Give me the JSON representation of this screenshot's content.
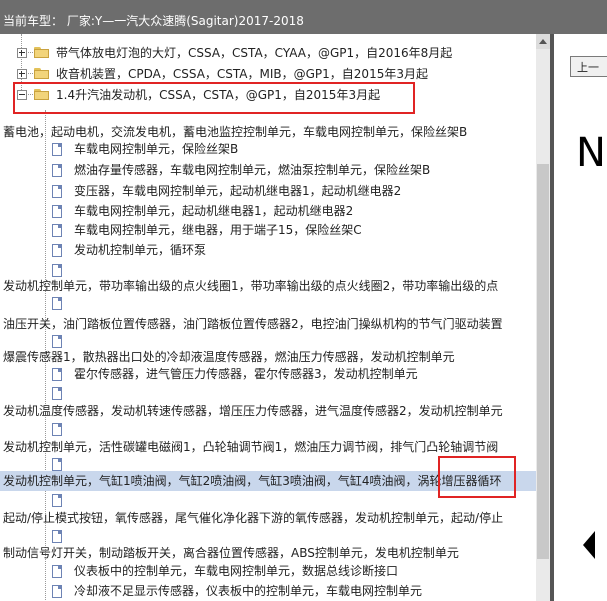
{
  "header": {
    "title": "当前车型： 厂家:Y—一汽大众速腾(Sagitar)2017-2018"
  },
  "tree": {
    "folders": [
      "带气体放电灯泡的大灯，CSSA，CSTA，CYAA，@GP1，自2016年8月起",
      "收音机装置，CPDA，CSSA，CSTA，MIB，@GP1，自2015年3月起",
      "1.4升汽油发动机，CSSA，CSTA，@GP1，自2015年3月起"
    ],
    "rows": [
      "蓄电池，起动电机，交流发电机，蓄电池监控控制单元，车载电网控制单元，保险丝架B",
      "车载电网控制单元，保险丝架B",
      "燃油存量传感器，车载电网控制单元，燃油泵控制单元，保险丝架B",
      "变压器，车载电网控制单元，起动机继电器1，起动机继电器2",
      "车载电网控制单元，起动机继电器1，起动机继电器2",
      "车载电网控制单元，继电器，用于端子15，保险丝架C",
      "发动机控制单元，循环泵",
      "",
      "发动机控制单元，带功率输出级的点火线圈1，带功率输出级的点火线圈2，带功率输出级的点",
      "",
      "油压开关，油门踏板位置传感器，油门踏板位置传感器2，电控油门操纵机构的节气门驱动装置",
      "",
      "爆震传感器1，散热器出口处的冷却液温度传感器，燃油压力传感器，发动机控制单元",
      "霍尔传感器，进气管压力传感器，霍尔传感器3，发动机控制单元",
      "",
      "发动机温度传感器，发动机转速传感器，增压压力传感器，进气温度传感器2，发动机控制单元",
      "",
      "发动机控制单元，活性碳罐电磁阀1，凸轮轴调节阀1，燃油压力调节阀，排气门凸轮轴调节阀",
      "",
      "发动机控制单元，气缸1喷油阀，气缸2喷油阀，气缸3喷油阀，气缸4喷油阀，涡轮增压器循环",
      "",
      "起动/停止模式按钮，氧传感器，尾气催化净化器下游的氧传感器，发动机控制单元，起动/停止",
      "",
      "制动信号灯开关，制动踏板开关，离合器位置传感器，ABS控制单元，发电机控制单元",
      "仪表板中的控制单元，车载电网控制单元，数据总线诊断接口",
      "冷却液不足显示传感器，仪表板中的控制单元，车载电网控制单元"
    ]
  },
  "right_pane": {
    "nav_button_label": "上一",
    "big_text": "N"
  },
  "colors": {
    "highlight_border": "#e02424",
    "selected_row": "#c9d7ec",
    "header_bg": "#6d6d6d"
  }
}
